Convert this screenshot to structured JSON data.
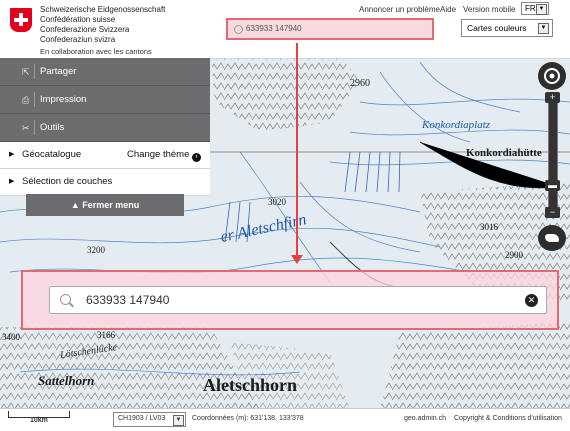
{
  "header": {
    "confederation_lines": [
      "Schweizerische Eidgenossenschaft",
      "Confédération suisse",
      "Confederazione Svizzera",
      "Confederaziun svizra"
    ],
    "collaboration": "En collaboration avec les cantons",
    "search_value": "633933 147940",
    "links": {
      "report": "Annoncer un problème",
      "help": "Aide",
      "mobile": "Version mobile"
    },
    "language": "FR",
    "background_layer": "Cartes couleurs"
  },
  "menu": {
    "share": "Partager",
    "print": "Impression",
    "tools": "Outils",
    "catalog": "Géocatalogue",
    "change_theme": "Change thème",
    "layer_selection": "Sélection de couches",
    "close": "▲ Fermer menu"
  },
  "map_labels": {
    "peak_2960": "2960",
    "konkordiaplatz_italic": "Konkordiaplatz",
    "konkordia_bold": "Konkordiahütte",
    "aletschfirn": "er Aletschfirn",
    "h3200": "3200",
    "h3016": "3016",
    "h2900": "2900",
    "h3020": "3020",
    "h3400": "3400",
    "h3166": "3166",
    "lucke": "Lötschenlücke",
    "sattelhorn": "Sattelhorn",
    "aletschhorn": "Aletschhorn"
  },
  "zoom_search": {
    "value": "633933 147940",
    "clear_icon": "✕"
  },
  "footer": {
    "scale": "10km",
    "projection": "CH1903 / LV03",
    "coordinates": "Coordonnées (m): 631'138, 133'378",
    "site": "geo.admin.ch",
    "copyright": "Copyright & Conditions d'utilisation"
  },
  "colors": {
    "accent_red": "#e3423e",
    "menu_gray": "#6b6d6f",
    "glacier_blue": "#1f55a8"
  }
}
